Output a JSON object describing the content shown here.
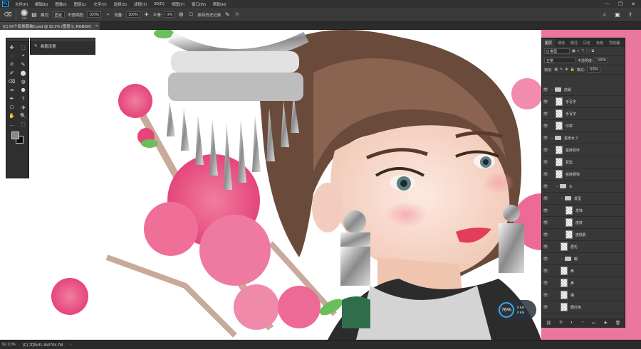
{
  "menubar": {
    "logo": "Ps",
    "items": [
      "文件(F)",
      "编辑(E)",
      "图像(I)",
      "图层(L)",
      "文字(Y)",
      "选择(S)",
      "滤镜(T)",
      "3D(D)",
      "视图(V)",
      "窗口(W)",
      "帮助(H)"
    ],
    "window_controls": [
      "—",
      "❐",
      "✕"
    ]
  },
  "options": {
    "brush_size": "100",
    "mode_label": "模式:",
    "mode_value": "固定",
    "opacity_label": "不透明度:",
    "opacity_value": "100%",
    "flow_label": "流量:",
    "flow_value": "100%",
    "smooth_label": "平滑:",
    "smooth_value": "0%",
    "history_label": "抹到历史记录"
  },
  "document": {
    "tab_title": "(C) 56个民族服装5.psd @ 92.2% (图层 0, RGB/8#)",
    "close": "×"
  },
  "brush_flyout": {
    "label": "画笔设置"
  },
  "tools": [
    "✥",
    "⬚",
    "◌",
    "⌖",
    "⧄",
    "✎",
    "✐",
    "⬤",
    "⌫",
    "◍",
    "♒",
    "⬣",
    "✒",
    "T",
    "⬠",
    "⬗",
    "✋",
    "🔍",
    "…",
    "⬚"
  ],
  "layers_panel": {
    "tabs": [
      "图层",
      "通道",
      "路径",
      "历史",
      "色板",
      "导航器"
    ],
    "kind_label": "Q 类型",
    "blend_mode": "正常",
    "opacity_label": "不透明度:",
    "opacity_value": "100%",
    "lock_label": "锁定:",
    "fill_label": "填充:",
    "fill_value": "100%",
    "layers": [
      {
        "name": "前景",
        "type": "folder",
        "indent": 0
      },
      {
        "name": "手写字",
        "type": "layer",
        "indent": 1
      },
      {
        "name": "手写字",
        "type": "layer",
        "indent": 1
      },
      {
        "name": "印章",
        "type": "layer",
        "indent": 1
      },
      {
        "name": "苗家女 2",
        "type": "folder",
        "indent": 0
      },
      {
        "name": "苗族耳环",
        "type": "layer",
        "indent": 1
      },
      {
        "name": "耳坠",
        "type": "layer",
        "indent": 1
      },
      {
        "name": "苗族颈饰",
        "type": "layer",
        "indent": 1
      },
      {
        "name": "头",
        "type": "folder",
        "indent": 1
      },
      {
        "name": "发型",
        "type": "folder",
        "indent": 2
      },
      {
        "name": "发饰",
        "type": "layer",
        "indent": 3
      },
      {
        "name": "皮肤",
        "type": "layer",
        "indent": 3
      },
      {
        "name": "皮肤影",
        "type": "layer",
        "indent": 3
      },
      {
        "name": "眉毛",
        "type": "layer",
        "indent": 2
      },
      {
        "name": "眼",
        "type": "folder",
        "indent": 2
      },
      {
        "name": "鼻",
        "type": "layer",
        "indent": 2
      },
      {
        "name": "鼻",
        "type": "layer",
        "indent": 2
      },
      {
        "name": "嘴",
        "type": "layer",
        "indent": 2
      },
      {
        "name": "腮红色",
        "type": "layer",
        "indent": 2
      }
    ],
    "footer_icons": [
      "⛓",
      "fx",
      "◐",
      "◔",
      "▭",
      "✚",
      "🗑"
    ]
  },
  "perf": {
    "percent": "76%",
    "up": "0 K/s",
    "down": "0 K/s"
  },
  "status": {
    "zoom": "92.21%",
    "doc_info": "(C) 文档:81.4M/704.7M",
    "arrow": "›"
  },
  "colors": {
    "accent_blue": "#31a8ff",
    "dock_pink": "#e9779e",
    "panel_bg": "#383838"
  }
}
